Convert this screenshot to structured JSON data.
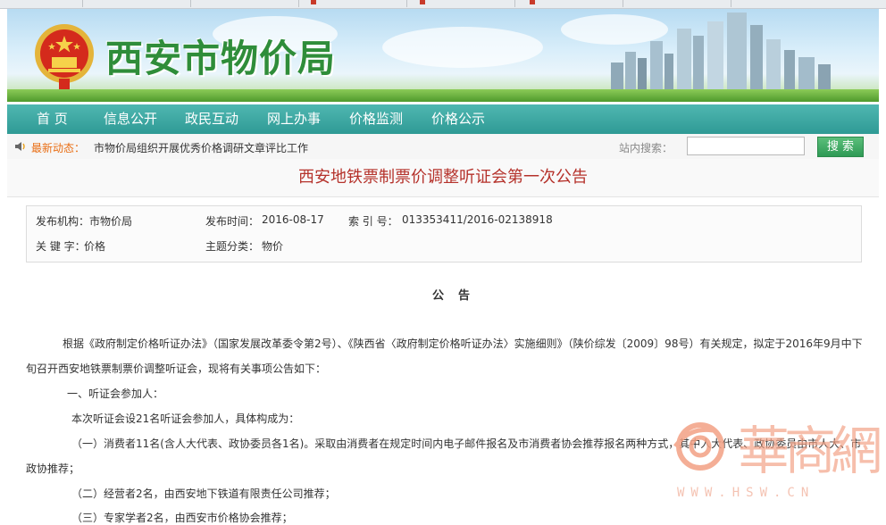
{
  "site": {
    "title": "西安市物价局"
  },
  "nav": {
    "items": [
      "首  页",
      "信息公开",
      "政民互动",
      "网上办事",
      "价格监测",
      "价格公示"
    ]
  },
  "ticker": {
    "label": "最新动态：",
    "news": "市物价局组织开展优秀价格调研文章评比工作",
    "search_label": "站内搜索：",
    "search_value": "",
    "search_button": "搜 索"
  },
  "article": {
    "title": "西安地铁票制票价调整听证会第一次公告",
    "meta": {
      "org_label": "发布机构：",
      "org": "市物价局",
      "date_label": "发布时间：",
      "date": "2016-08-17",
      "index_label": "索 引 号：",
      "index": "013353411/2016-02138918",
      "keyword_label": "关 键 字：",
      "keyword": "价格",
      "category_label": "主题分类：",
      "category": "物价"
    },
    "heading": "公告",
    "paragraphs": [
      "根据《政府制定价格听证办法》（国家发展改革委令第2号）、《陕西省〈政府制定价格听证办法〉实施细则》（陕价综发〔2009〕98号）有关规定，拟定于2016年9月中下",
      "旬召开西安地铁票制票价调整听证会，现将有关事项公告如下：",
      "一、听证会参加人：",
      "本次听证会设21名听证会参加人，具体构成为：",
      "（一）消费者11名(含人大代表、政协委员各1名)。采取由消费者在规定时间内电子邮件报名及市消费者协会推荐报名两种方式，其中人大代表、政协委员由市人大、市",
      "政协推荐；",
      "（二）经营者2名，由西安地下铁道有限责任公司推荐；",
      "（三）专家学者2名，由西安市价格协会推荐；"
    ]
  },
  "watermark": {
    "chars": "華商網",
    "url": "WWW.HSW.CN"
  }
}
